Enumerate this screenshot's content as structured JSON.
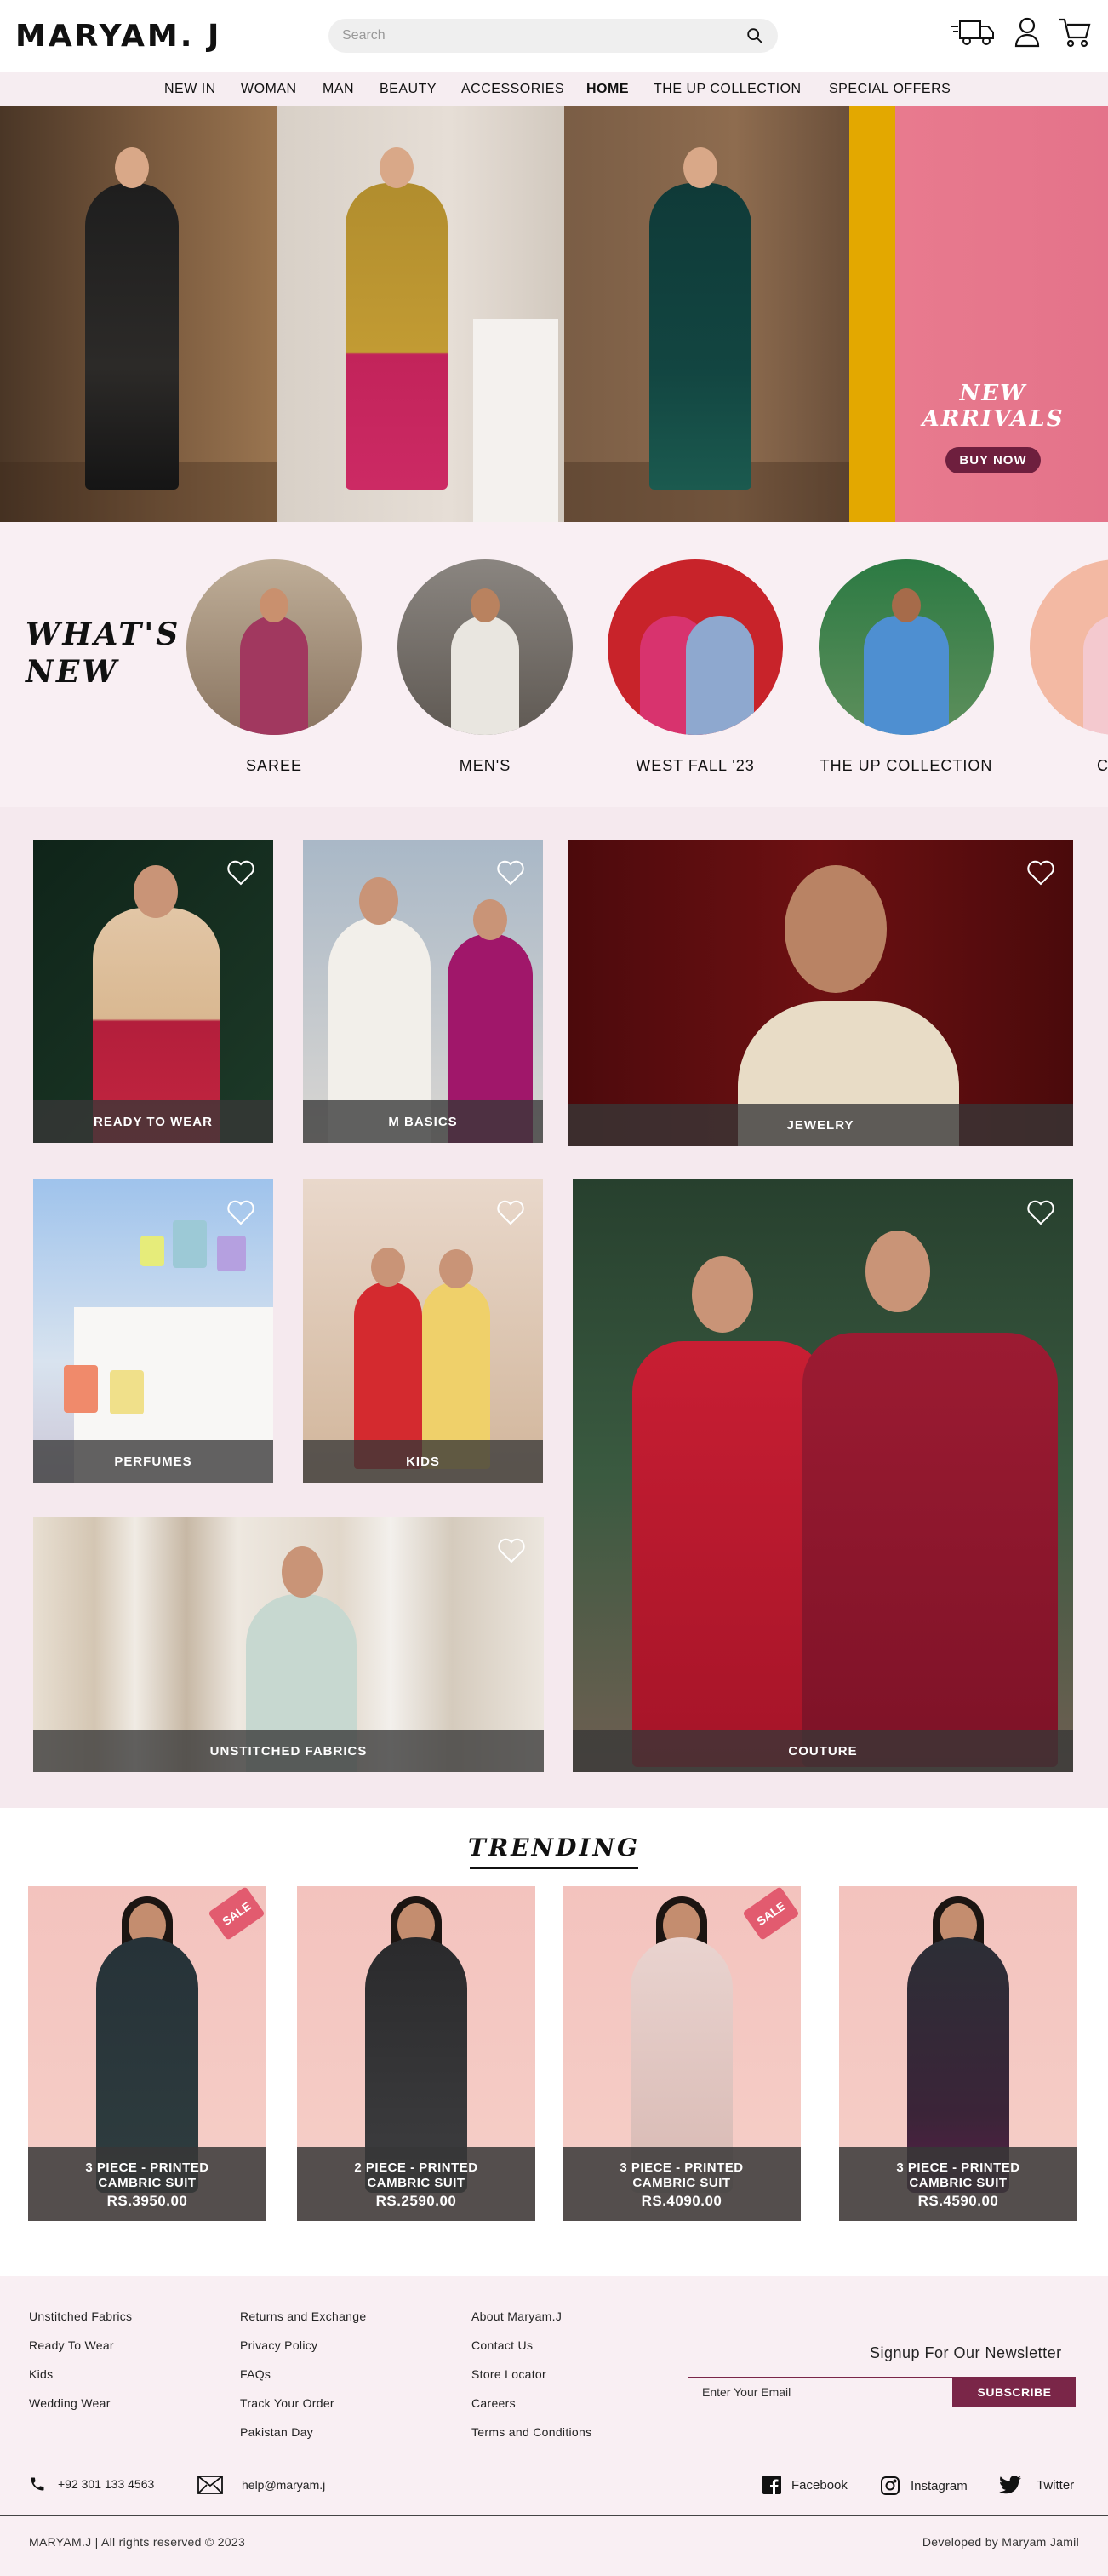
{
  "header": {
    "logo": "MARYAM. J",
    "search_placeholder": "Search"
  },
  "nav": {
    "items": [
      "NEW IN",
      "WOMAN",
      "MAN",
      "BEAUTY",
      "ACCESSORIES",
      "HOME",
      "THE UP COLLECTION",
      "SPECIAL OFFERS"
    ],
    "active": "HOME"
  },
  "hero": {
    "title": "NEW ARRIVALS",
    "button": "BUY NOW"
  },
  "whats_new": {
    "title": "WHAT'S\nNEW",
    "items": [
      "SAREE",
      "MEN'S",
      "WEST FALL '23",
      "THE UP COLLECTION",
      "CHIC"
    ]
  },
  "categories": [
    "READY TO WEAR",
    "M BASICS",
    "JEWELRY",
    "PERFUMES",
    "KIDS",
    "UNSTITCHED FABRICS",
    "COUTURE"
  ],
  "trending": {
    "title": "TRENDING",
    "sale_label": "SALE",
    "products": [
      {
        "name_line1": "3 PIECE - PRINTED",
        "name_line2": "CAMBRIC SUIT",
        "price": "RS.3950.00"
      },
      {
        "name_line1": "2 PIECE - PRINTED",
        "name_line2": "CAMBRIC SUIT",
        "price": "RS.2590.00"
      },
      {
        "name_line1": "3 PIECE - PRINTED",
        "name_line2": "CAMBRIC SUIT",
        "price": "RS.4090.00"
      },
      {
        "name_line1": "3 PIECE - PRINTED",
        "name_line2": "CAMBRIC SUIT",
        "price": "RS.4590.00"
      }
    ]
  },
  "footer": {
    "col1": [
      "Unstitched Fabrics",
      "Ready To Wear",
      "Kids",
      "Wedding Wear"
    ],
    "col2": [
      "Returns and Exchange",
      "Privacy Policy",
      "FAQs",
      "Track Your Order",
      "Pakistan Day"
    ],
    "col3": [
      "About Maryam.J",
      "Contact Us",
      "Store Locator",
      "Careers",
      "Terms and Conditions"
    ],
    "newsletter_title": "Signup For Our Newsletter",
    "email_placeholder": "Enter Your Email",
    "subscribe": "SUBSCRIBE",
    "phone": "+92 301 133 4563",
    "email": "help@maryam.j",
    "social": [
      "Facebook",
      "Instagram",
      "Twitter"
    ],
    "copyright": "MARYAM.J  |  All rights reserved © 2023",
    "developer": "Developed by Maryam Jamil"
  },
  "colors": {
    "accent": "#7a2648",
    "nav_bg": "#f6edf1",
    "section_bg": "#f5e9ee",
    "card_bar": "#373737"
  }
}
